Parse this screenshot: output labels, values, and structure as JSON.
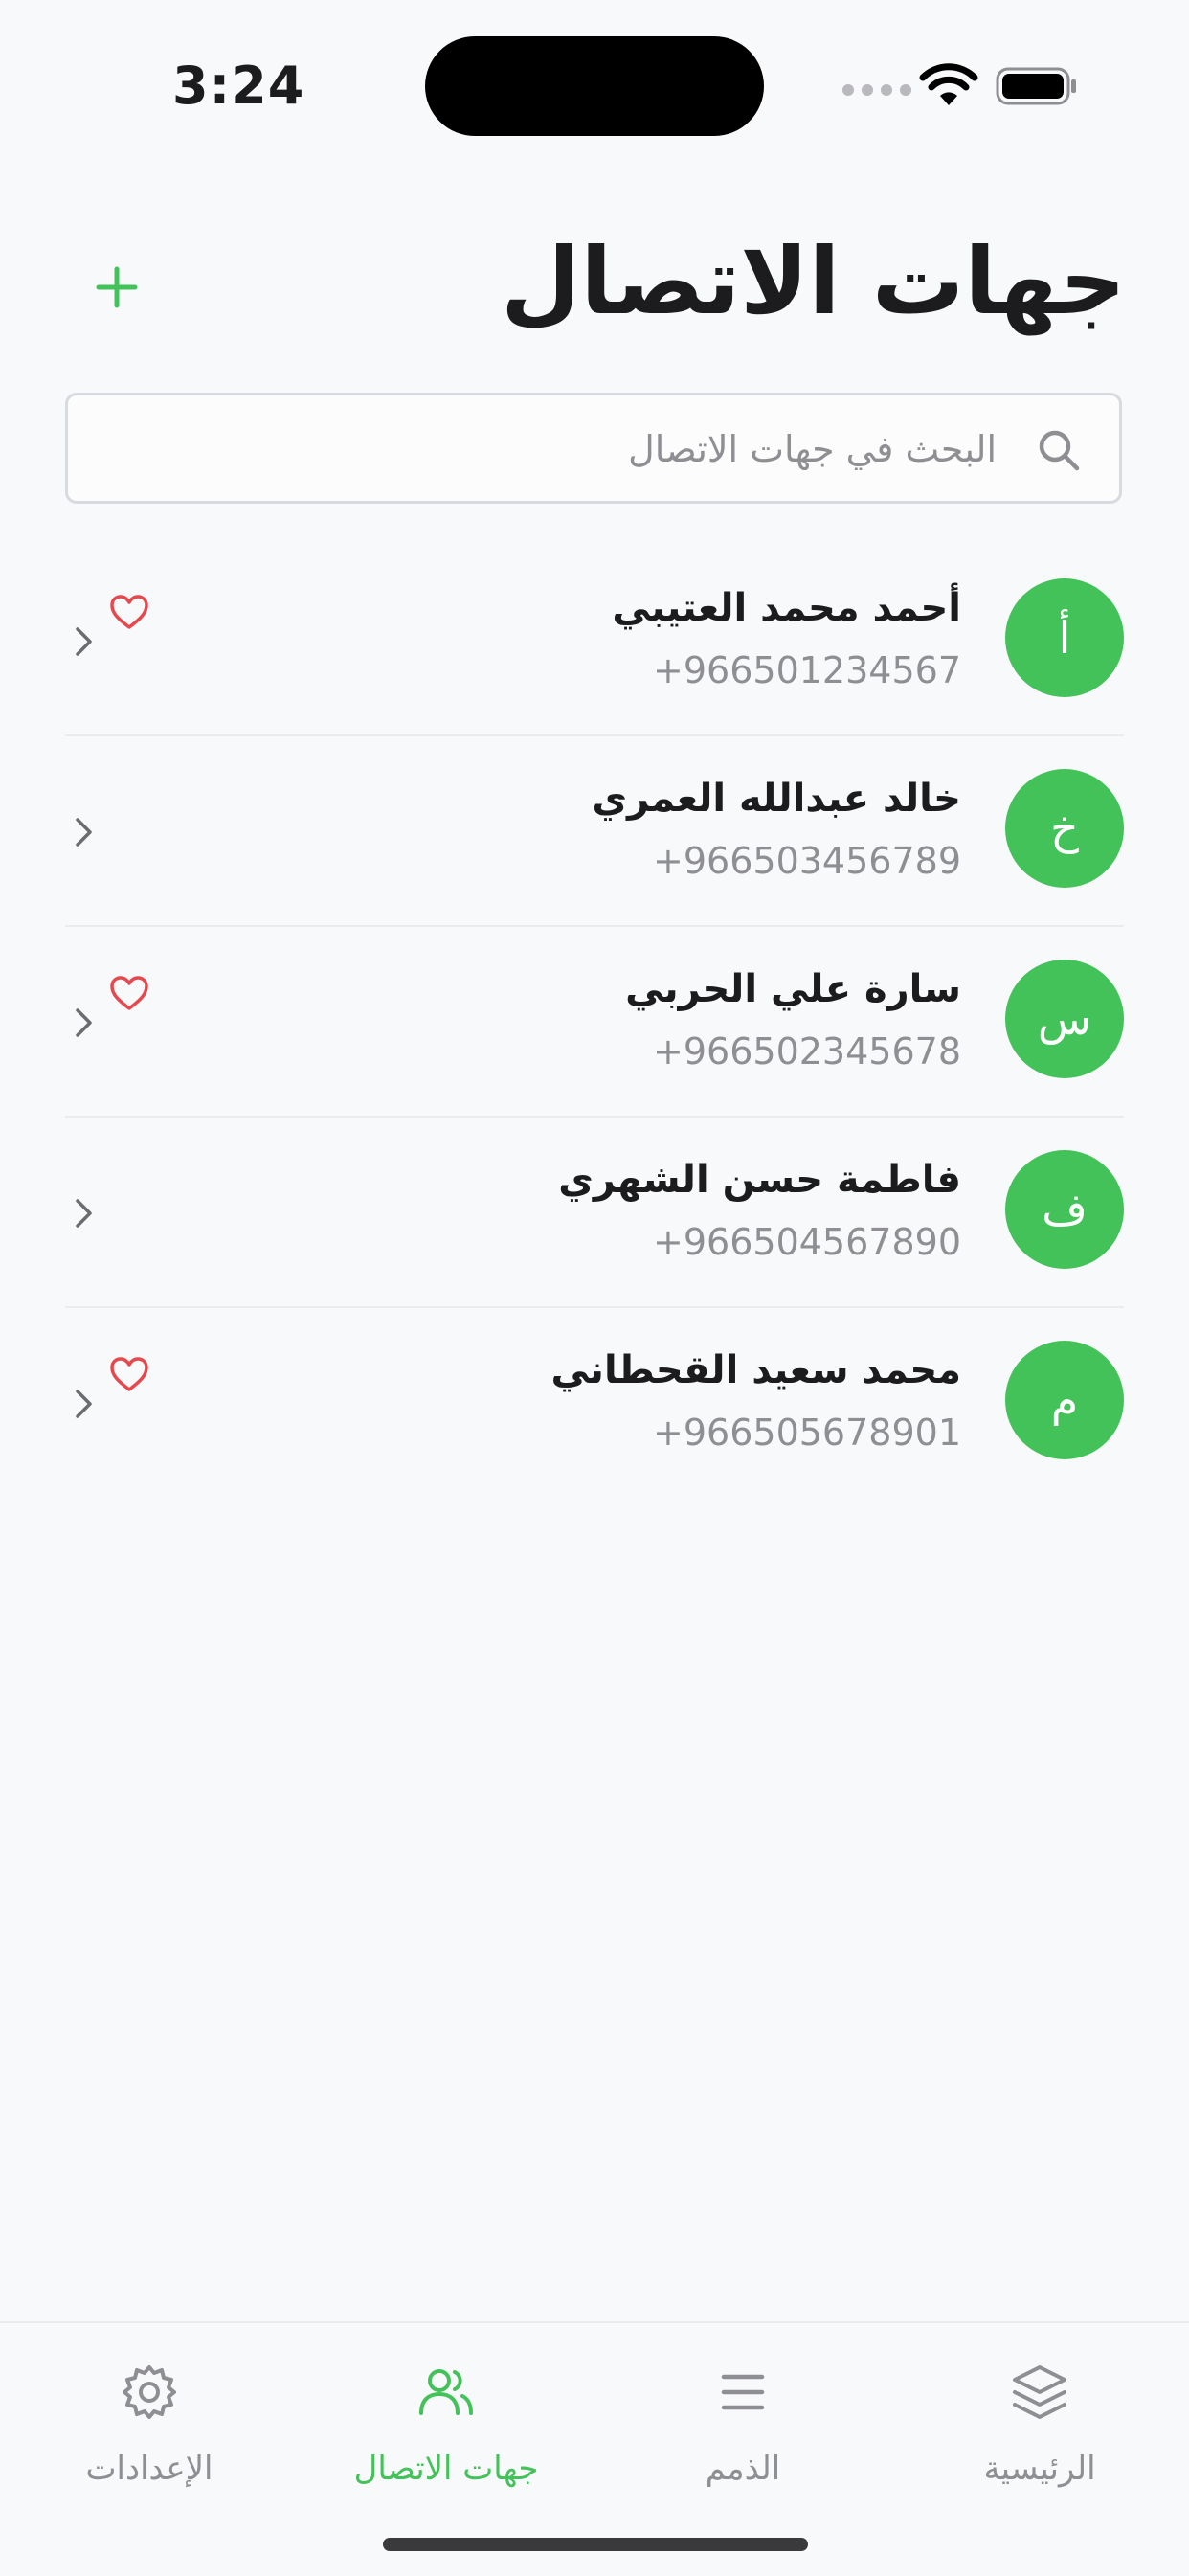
{
  "status_bar": {
    "time": "3:24"
  },
  "header": {
    "title": "جهات الاتصال"
  },
  "search": {
    "placeholder": "البحث في جهات الاتصال"
  },
  "colors": {
    "accent": "#44c25a",
    "favorite": "#e5484d",
    "muted": "#8e8e93"
  },
  "contacts": [
    {
      "initial": "أ",
      "name": "أحمد محمد العتيبي",
      "phone": "+966501234567",
      "favorite": true
    },
    {
      "initial": "خ",
      "name": "خالد عبدالله العمري",
      "phone": "+966503456789",
      "favorite": false
    },
    {
      "initial": "س",
      "name": "سارة علي الحربي",
      "phone": "+966502345678",
      "favorite": true
    },
    {
      "initial": "ف",
      "name": "فاطمة حسن الشهري",
      "phone": "+966504567890",
      "favorite": false
    },
    {
      "initial": "م",
      "name": "محمد سعيد القحطاني",
      "phone": "+966505678901",
      "favorite": true
    }
  ],
  "tabs": [
    {
      "label": "الرئيسية",
      "icon": "layers-icon",
      "active": false
    },
    {
      "label": "الذمم",
      "icon": "menu-icon",
      "active": false
    },
    {
      "label": "جهات الاتصال",
      "icon": "users-icon",
      "active": true
    },
    {
      "label": "الإعدادات",
      "icon": "gear-icon",
      "active": false
    }
  ]
}
